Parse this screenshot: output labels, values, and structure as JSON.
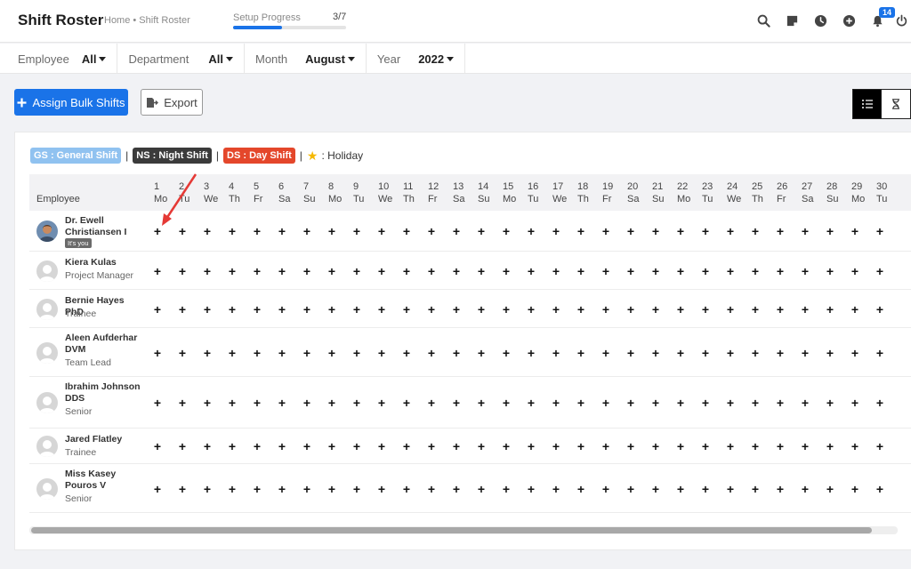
{
  "header": {
    "title": "Shift Roster",
    "breadcrumb": "Home • Shift Roster",
    "progress_label": "Setup Progress",
    "progress_count": "3/7",
    "progress_fraction": 0.43,
    "notification_count": "14",
    "icons": [
      "search-icon",
      "sticky-note-icon",
      "clock-icon",
      "add-circle-icon",
      "bell-icon",
      "power-icon"
    ]
  },
  "filters": [
    {
      "label": "Employee",
      "value": "All"
    },
    {
      "label": "Department",
      "value": "All"
    },
    {
      "label": "Month",
      "value": "August"
    },
    {
      "label": "Year",
      "value": "2022"
    }
  ],
  "actions": {
    "assign_label": "Assign Bulk Shifts",
    "export_label": "Export"
  },
  "legend": {
    "gs": "GS : General Shift",
    "ns": "NS : Night Shift",
    "ds": "DS : Day Shift",
    "holiday": ": Holiday"
  },
  "colors": {
    "primary": "#1a73e8",
    "general_shift": "#90c2f0",
    "night_shift": "#3b3b3b",
    "day_shift": "#e4472b",
    "holiday_star": "#f5b800",
    "annotation_arrow": "#e53935"
  },
  "table": {
    "employee_header": "Employee",
    "days": [
      {
        "num": "1",
        "dow": "Mo"
      },
      {
        "num": "2",
        "dow": "Tu"
      },
      {
        "num": "3",
        "dow": "We"
      },
      {
        "num": "4",
        "dow": "Th"
      },
      {
        "num": "5",
        "dow": "Fr"
      },
      {
        "num": "6",
        "dow": "Sa"
      },
      {
        "num": "7",
        "dow": "Su"
      },
      {
        "num": "8",
        "dow": "Mo"
      },
      {
        "num": "9",
        "dow": "Tu"
      },
      {
        "num": "10",
        "dow": "We"
      },
      {
        "num": "11",
        "dow": "Th"
      },
      {
        "num": "12",
        "dow": "Fr"
      },
      {
        "num": "13",
        "dow": "Sa"
      },
      {
        "num": "14",
        "dow": "Su"
      },
      {
        "num": "15",
        "dow": "Mo"
      },
      {
        "num": "16",
        "dow": "Tu"
      },
      {
        "num": "17",
        "dow": "We"
      },
      {
        "num": "18",
        "dow": "Th"
      },
      {
        "num": "19",
        "dow": "Fr"
      },
      {
        "num": "20",
        "dow": "Sa"
      },
      {
        "num": "21",
        "dow": "Su"
      },
      {
        "num": "22",
        "dow": "Mo"
      },
      {
        "num": "23",
        "dow": "Tu"
      },
      {
        "num": "24",
        "dow": "We"
      },
      {
        "num": "25",
        "dow": "Th"
      },
      {
        "num": "26",
        "dow": "Fr"
      },
      {
        "num": "27",
        "dow": "Sa"
      },
      {
        "num": "28",
        "dow": "Su"
      },
      {
        "num": "29",
        "dow": "Mo"
      },
      {
        "num": "30",
        "dow": "Tu"
      }
    ],
    "add_symbol": "+",
    "employees": [
      {
        "name": "Dr. Ewell Christiansen I",
        "role": "",
        "badge": "It's you"
      },
      {
        "name": "Kiera Kulas",
        "role": "Project Manager",
        "badge": ""
      },
      {
        "name": "Bernie Hayes PhD",
        "role": "Trainee",
        "badge": ""
      },
      {
        "name": "Aleen Aufderhar DVM",
        "role": "Team Lead",
        "badge": ""
      },
      {
        "name": "Ibrahim Johnson DDS",
        "role": "Senior",
        "badge": ""
      },
      {
        "name": "Jared Flatley",
        "role": "Trainee",
        "badge": ""
      },
      {
        "name": "Miss Kasey Pouros V",
        "role": "Senior",
        "badge": ""
      }
    ]
  }
}
